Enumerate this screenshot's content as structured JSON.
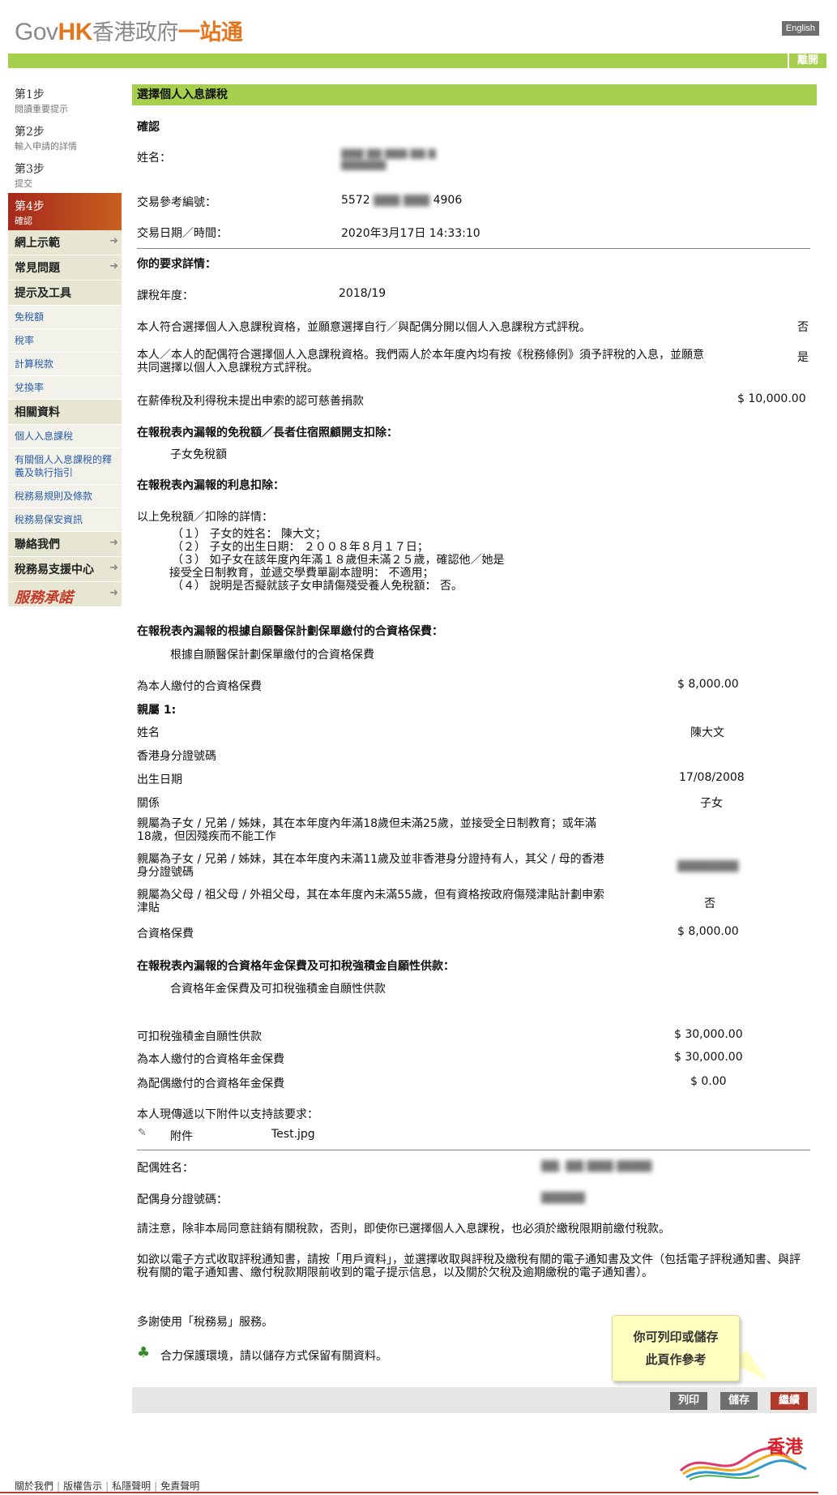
{
  "header": {
    "logo": {
      "gov": "Gov",
      "hk": "HK",
      "zh1": "香港政府",
      "zh2": "一站通"
    },
    "lang": "English",
    "logout": "離開"
  },
  "sidebar": {
    "steps": [
      {
        "title": "第1步",
        "desc": "閱讀重要提示"
      },
      {
        "title": "第2步",
        "desc": "輸入申請的詳情"
      },
      {
        "title": "第3步",
        "desc": "提交"
      },
      {
        "title": "第4步",
        "desc": "確認"
      }
    ],
    "sections": {
      "demo": "網上示範",
      "faq": "常見問題",
      "tools": "提示及工具",
      "related": "相關資料",
      "contact": "聯絡我們",
      "support": "稅務易支援中心"
    },
    "tool_links": [
      "免稅額",
      "稅率",
      "計算稅款",
      "兌換率"
    ],
    "related_links": [
      "個人入息課稅",
      "有關個人入息課稅的釋義及執行指引",
      "稅務易規則及條款",
      "稅務易保安資訊"
    ],
    "service_logo": "服務承諾"
  },
  "main": {
    "title": "選擇個人入息課稅",
    "confirm_heading": "確認",
    "name_label": "姓名：",
    "ref_label": "交易參考編號：",
    "ref_prefix": "5572",
    "ref_suffix": "4906",
    "date_label": "交易日期／時間：",
    "date_value": "2020年3月17日  14:33:10",
    "details_heading": "你的要求詳情：",
    "year_label": "課稅年度：",
    "year_value": "2018/19",
    "q1": "本人符合選擇個人入息課稅資格，並願意選擇自行／與配偶分開以個人入息課稅方式評稅。",
    "q1_value": "否",
    "q2": "本人／本人的配偶符合選擇個人入息課稅資格。我們兩人於本年度內均有按《稅務條例》須予評稅的入息，並願意共同選擇以個人入息課稅方式評稅。",
    "q2_value": "是",
    "charity_label": "在薪俸稅及利得稅未提出申索的認可慈善捐款",
    "charity_value": "$ 10,000.00",
    "allowance_heading": "在報稅表內漏報的免稅額／長者住宿照顧開支扣除：",
    "allowance_item": "子女免稅額",
    "interest_heading": "在報稅表內漏報的利息扣除：",
    "detail_intro": "以上免稅額／扣除的詳情：",
    "detail_lines": [
      "（１）  子女的姓名：  陳大文；",
      "（２）  子女的出生日期：  ２００８年８月１７日；",
      "（３）  如子女在該年度內年滿１８歲但未滿２５歲，確認他／她是",
      "接受全日制教育，並遞交學費單副本證明：  不適用；",
      "（４）  說明是否擬就該子女申請傷殘受養人免稅額：  否。"
    ],
    "vhis_heading": "在報稅表內漏報的根據自願醫保計劃保單繳付的合資格保費：",
    "vhis_item": "根據自願醫保計劃保單繳付的合資格保費",
    "self_premium_label": "為本人繳付的合資格保費",
    "self_premium_value": "$ 8,000.00",
    "relative_heading": "親屬 1:",
    "rel_name_label": "姓名",
    "rel_name_value": "陳大文",
    "rel_hkid_label": "香港身分證號碼",
    "rel_dob_label": "出生日期",
    "rel_dob_value": "17/08/2008",
    "rel_relation_label": "關係",
    "rel_relation_value": "子女",
    "rel_q1": "親屬為子女 / 兄弟 / 姊妹，其在本年度內年滿18歲但未滿25歲，並接受全日制教育；或年滿18歲，但因殘疾而不能工作",
    "rel_q2": "親屬為子女 / 兄弟 / 姊妹，其在本年度內未滿11歲及並非香港身分證持有人，其父 / 母的香港身分證號碼",
    "rel_q3": "親屬為父母 / 祖父母 / 外祖父母，其在本年度內未滿55歲，但有資格按政府傷殘津貼計劃申索津貼",
    "rel_q3_value": "否",
    "rel_premium_label": "合資格保費",
    "rel_premium_value": "$ 8,000.00",
    "mpf_heading": "在報稅表內漏報的合資格年金保費及可扣稅強積金自願性供款：",
    "mpf_item": "合資格年金保費及可扣稅強積金自願性供款",
    "mpf_tvc_label": "可扣稅強積金自願性供款",
    "mpf_tvc_value": "$ 30,000.00",
    "annuity_self_label": "為本人繳付的合資格年金保費",
    "annuity_self_value": "$ 30,000.00",
    "annuity_spouse_label": "為配偶繳付的合資格年金保費",
    "annuity_spouse_value": "$ 0.00",
    "attach_intro": "本人現傳遞以下附件以支持該要求：",
    "attach_label": "附件",
    "attach_file": "Test.jpg",
    "spouse_name_label": "配偶姓名：",
    "spouse_id_label": "配偶身分證號碼：",
    "notice1": "請注意，除非本局同意註銷有關稅款，否則，即使你已選擇個人入息課稅，也必須於繳稅限期前繳付稅款。",
    "notice2": "如欲以電子方式收取評稅通知書，請按「用戶資料」，並選擇收取與評稅及繳稅有關的電子通知書及文件（包括電子評稅通知書、與評稅有關的電子通知書、繳付稅款期限前收到的電子提示信息，以及關於欠稅及逾期繳稅的電子通知書）。",
    "thanks": "多謝使用「稅務易」服務。",
    "green_note": "合力保護環境，請以儲存方式保留有關資料。"
  },
  "tooltip": {
    "line1": "你可列印或儲存",
    "line2": "此頁作參考"
  },
  "actions": {
    "print": "列印",
    "save": "儲存",
    "next": "繼續"
  },
  "footer": {
    "links": [
      "關於我們",
      "版權告示",
      "私隱聲明",
      "免責聲明"
    ],
    "brand": "香港"
  }
}
